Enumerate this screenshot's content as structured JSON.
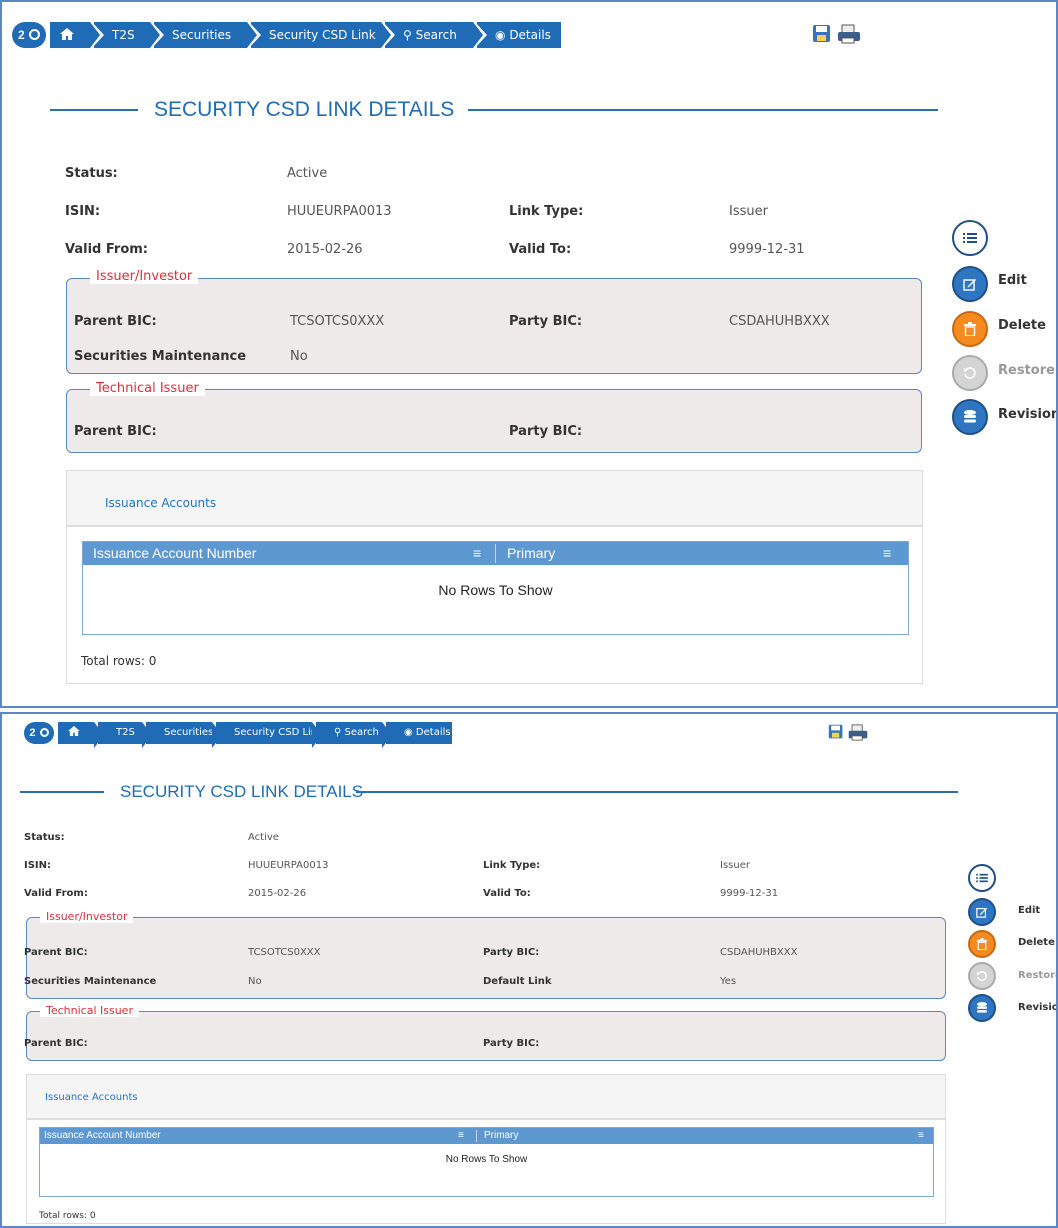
{
  "breadcrumb": {
    "badge": "2",
    "items": [
      "T2S",
      "Securities",
      "Security CSD Link",
      "Search",
      "Details"
    ]
  },
  "page_title": "SECURITY CSD LINK DETAILS",
  "fields": {
    "status_label": "Status:",
    "status_value": "Active",
    "isin_label": "ISIN:",
    "isin_value": "HUUEURPA0013",
    "link_type_label": "Link Type:",
    "link_type_value": "Issuer",
    "valid_from_label": "Valid From:",
    "valid_from_value": "2015-02-26",
    "valid_to_label": "Valid To:",
    "valid_to_value": "9999-12-31"
  },
  "issuer_investor": {
    "legend": "Issuer/Investor",
    "parent_bic_label": "Parent BIC:",
    "parent_bic_value": "TCSOTCS0XXX",
    "party_bic_label": "Party BIC:",
    "party_bic_value": "CSDAHUHBXXX",
    "sec_maint_label": "Securities Maintenance",
    "sec_maint_value": "No",
    "default_link_label": "Default Link",
    "default_link_value": "Yes"
  },
  "technical_issuer": {
    "legend": "Technical Issuer",
    "parent_bic_label": "Parent BIC:",
    "party_bic_label": "Party BIC:"
  },
  "issuance_accounts": {
    "panel_title": "Issuance Accounts",
    "columns": [
      "Issuance Account Number",
      "Primary"
    ],
    "menu_glyph": "≡",
    "empty_text": "No Rows To Show",
    "total_rows": "Total rows: 0"
  },
  "actions": {
    "edit": "Edit",
    "delete": "Delete",
    "restore": "Restore",
    "revisions": "Revisions"
  },
  "colors": {
    "brand_blue": "#1f6bb5",
    "legend_red": "#d9303a",
    "delete_orange": "#f58a1f"
  }
}
